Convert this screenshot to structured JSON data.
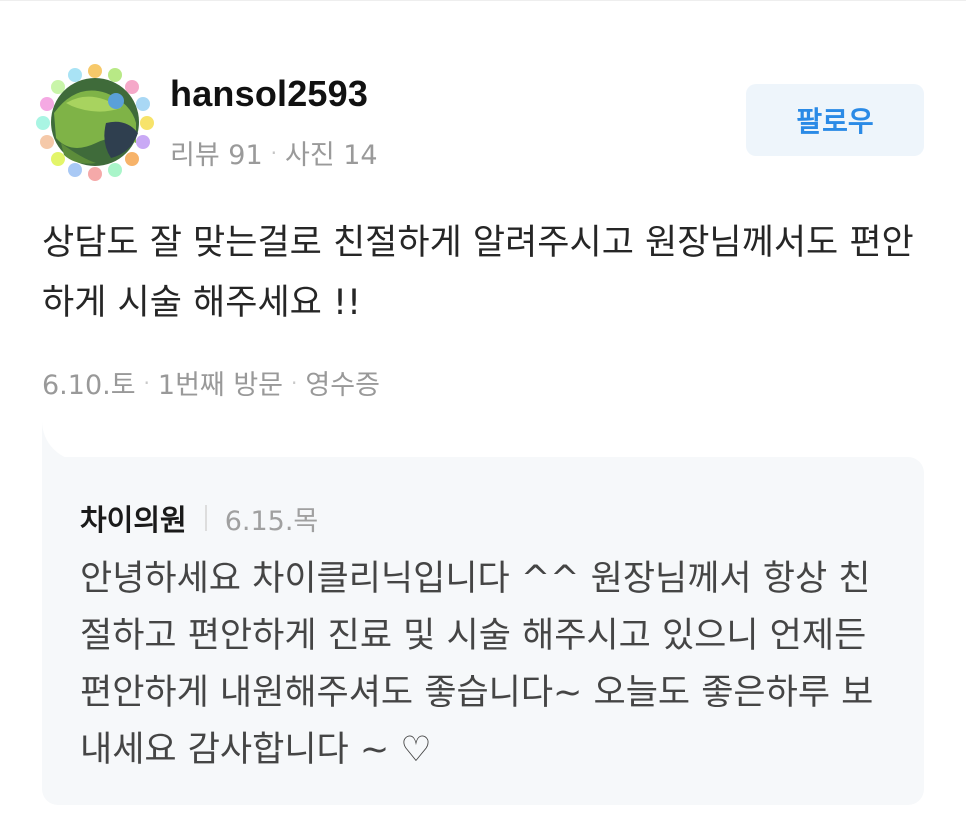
{
  "reviewer": {
    "username": "hansol2593",
    "reviews": "리뷰 91",
    "photos": "사진 14",
    "separator": "·"
  },
  "follow_button": {
    "label": "팔로우"
  },
  "review": {
    "text": "상담도 잘 맞는걸로 친절하게 알려주시고 원장님께서도 편안하게 시술 해주세요 !!",
    "date": "6.10.토",
    "visit": "1번째 방문",
    "verification": "영수증",
    "separator": "·"
  },
  "owner_reply": {
    "name": "차이의원",
    "date": "6.15.목",
    "text": "안녕하세요 차이클리닉입니다 ^^ 원장님께서 항상 친절하고 편안하게 진료 및 시술 해주시고 있으니 언제든 편안하게 내원해주셔도 좋습니다~ 오늘도 좋은하루 보내세요 감사합니다 ~ ♡"
  },
  "colors": {
    "follow_text": "#2a8ae6",
    "follow_bg": "#eef5fb",
    "reply_bg": "#f6f8fa",
    "muted_text": "#999999"
  },
  "icons": {
    "avatar": "reviewer-avatar-image"
  }
}
